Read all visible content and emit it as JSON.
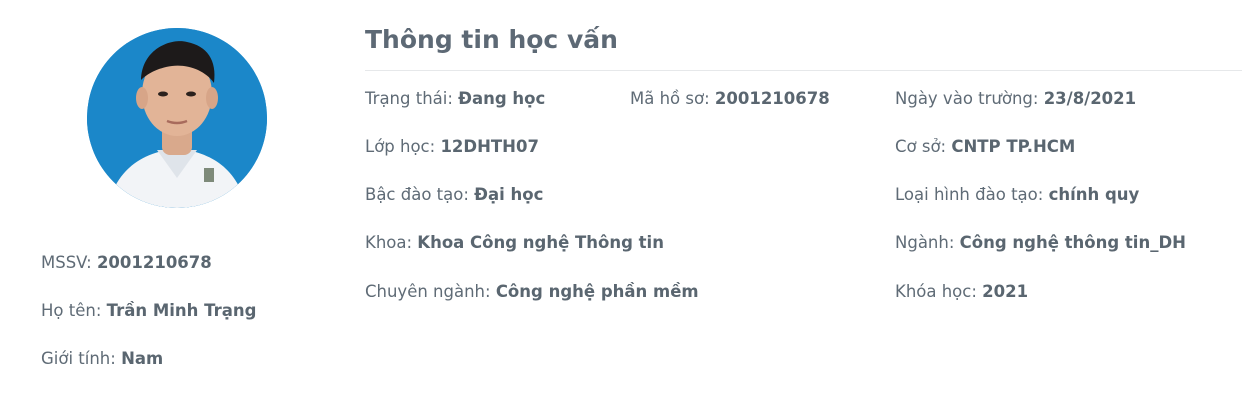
{
  "profile": {
    "mssv_label": "MSSV:",
    "mssv_value": "2001210678",
    "name_label": "Họ tên:",
    "name_value": "Trần Minh Trạng",
    "gender_label": "Giới tính:",
    "gender_value": "Nam"
  },
  "education": {
    "title": "Thông tin học vấn",
    "status_label": "Trạng thái:",
    "status_value": "Đang học",
    "record_label": "Mã hồ sơ:",
    "record_value": "2001210678",
    "enroll_label": "Ngày vào trường:",
    "enroll_value": "23/8/2021",
    "class_label": "Lớp học:",
    "class_value": "12DHTH07",
    "campus_label": "Cơ sở:",
    "campus_value": "CNTP TP.HCM",
    "level_label": "Bậc đào tạo:",
    "level_value": "Đại học",
    "type_label": "Loại hình đào tạo:",
    "type_value": "chính quy",
    "faculty_label": "Khoa:",
    "faculty_value": "Khoa Công nghệ Thông tin",
    "major_label": "Ngành:",
    "major_value": "Công nghệ thông tin_DH",
    "specialization_label": "Chuyên ngành:",
    "specialization_value": "Công nghệ phần mềm",
    "course_label": "Khóa học:",
    "course_value": "2021"
  },
  "colors": {
    "avatar_background": "#1b87c9",
    "text": "#5f6b76"
  }
}
